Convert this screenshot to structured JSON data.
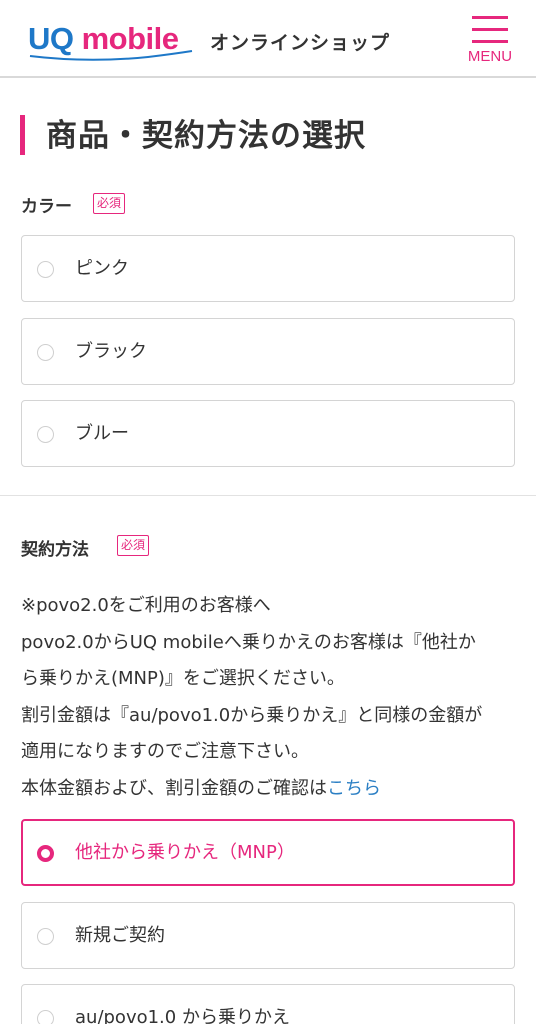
{
  "header": {
    "logo_uq": "UQ",
    "logo_mobile": " mobile",
    "shop_title": "オンラインショップ",
    "menu_label": "MENU"
  },
  "page_title": "商品・契約方法の選択",
  "color_section": {
    "label": "カラー",
    "required": "必須",
    "options": [
      {
        "label": "ピンク",
        "selected": false
      },
      {
        "label": "ブラック",
        "selected": false
      },
      {
        "label": "ブルー",
        "selected": false
      }
    ]
  },
  "contract_section": {
    "label": "契約方法",
    "required": "必須",
    "notice_lines": [
      "※povo2.0をご利用のお客様へ",
      "povo2.0からUQ mobileへ乗りかえのお客様は『他社か",
      "ら乗りかえ(MNP)』をご選択ください。",
      "割引金額は『au/povo1.0から乗りかえ』と同様の金額が",
      "適用になりますのでご注意下さい。"
    ],
    "notice_last_prefix": "本体金額および、割引金額のご確認は",
    "notice_link": "こちら",
    "options": [
      {
        "label": "他社から乗りかえ（MNP）",
        "selected": true
      },
      {
        "label": "新規ご契約",
        "selected": false
      },
      {
        "label": "au/povo1.0 から乗りかえ",
        "selected": false
      }
    ]
  },
  "colors": {
    "accent": "#e6277d",
    "logo_blue": "#1e78c8",
    "link": "#2b7fc4",
    "text": "#333333"
  }
}
